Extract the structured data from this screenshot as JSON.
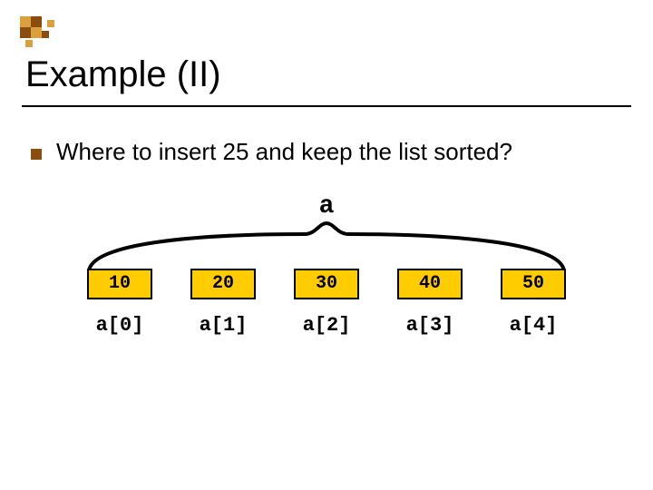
{
  "title": "Example (II)",
  "bullet": "Where to insert 25 and keep the list sorted?",
  "array_name": "a",
  "cells": [
    "10",
    "20",
    "30",
    "40",
    "50"
  ],
  "indices": [
    "a[0]",
    "a[1]",
    "a[2]",
    "a[3]",
    "a[4]"
  ]
}
